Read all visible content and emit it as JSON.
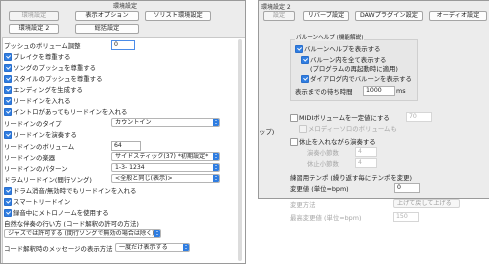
{
  "win1": {
    "title": "環境設定",
    "tabs": [
      "環境設定",
      "表示オプション",
      "ソリスト環境設定",
      "環境設定 2",
      "総括設定"
    ],
    "push_volume": {
      "label": "プッシュのボリューム調整",
      "value": "0"
    },
    "check_rows": [
      {
        "label": "ブレイクを尊重する",
        "checked": true
      },
      {
        "label": "ソングのプッシュを尊重する",
        "checked": true
      },
      {
        "label": "スタイルのプッシュを尊重する",
        "checked": true
      },
      {
        "label": "エンディングを生成する",
        "checked": true
      },
      {
        "label": "リードインを入れる",
        "checked": true
      },
      {
        "label": "イントロがあってもリードインを入れる",
        "checked": true
      }
    ],
    "leadin_type": {
      "label": "リードインのタイプ",
      "value": "カウントイン"
    },
    "leadin_play": {
      "label": "リードインを演奏する",
      "checked": true
    },
    "leadin_volume": {
      "label": "リードインのボリューム",
      "value": "64"
    },
    "leadin_instrument": {
      "label": "リードインの楽器",
      "value": "サイドスティック(37) *初期設定*"
    },
    "leadin_pattern": {
      "label": "リードインのパターン",
      "value": "1-3- 1234"
    },
    "drum_leadin": {
      "label": "ドラムリードイン(間行ソング)",
      "value": "<全般と同じ(表示)>"
    },
    "bottom_checks": [
      {
        "label": "ドラム消音/無効時でもリードインを入れる",
        "checked": true
      },
      {
        "label": "スマートリードイン",
        "checked": true
      },
      {
        "label": "録音中にメトロノームを使用する",
        "checked": true
      }
    ],
    "natural_leadin": {
      "label": "自然な伴奏の行い方 (コード解釈の許可の方法)",
      "value": "ジャズでは許可する (間行ソングで無効の場合は除く)"
    },
    "chord_msg": {
      "label": "コード解釈時のメッセージの表示方法",
      "value": "一度だけ表示する"
    }
  },
  "win2": {
    "title": "環境設定 2",
    "tabs": [
      "設定",
      "リバーブ設定",
      "DAWプラグイン設定",
      "オーディオ設定"
    ],
    "side_fragment": "ップ)",
    "balloon": {
      "title": "バルーンヘルプ (機能解説)",
      "show": "バルーンヘルプを表示する",
      "all_line1": "バルーン内を全て表示する",
      "all_line2": "(プログラムの再起動時に適用)",
      "dialog": "ダイアログ内でバルーンを表示する",
      "wait_label": "表示までの待ち時間",
      "wait_value": "1000",
      "wait_unit": "ms"
    },
    "midi_volume": {
      "label": "MIDIボリュームを一定値にする",
      "value": "70"
    },
    "melody_volume": {
      "label": "メロディーソロのボリュームも"
    },
    "rest": {
      "label": "休止を入れながら演奏する",
      "play_bars": "演奏小節数",
      "play_value": "4",
      "rest_bars": "休止小節数",
      "rest_value": "4"
    },
    "practice": {
      "title": "練習用テンポ (繰り返す毎にテンポを変更)",
      "change_label": "変更値 (単位=bpm)",
      "change_value": "0",
      "method_label": "変更方法",
      "method_value": "上げて戻して上げる",
      "max_label": "最高変更値 (単位=bpm)",
      "max_value": "150"
    }
  },
  "colors": {
    "accent": "#2f7de1",
    "window_bg": "#ececec",
    "panel_bg": "#ffffff"
  }
}
